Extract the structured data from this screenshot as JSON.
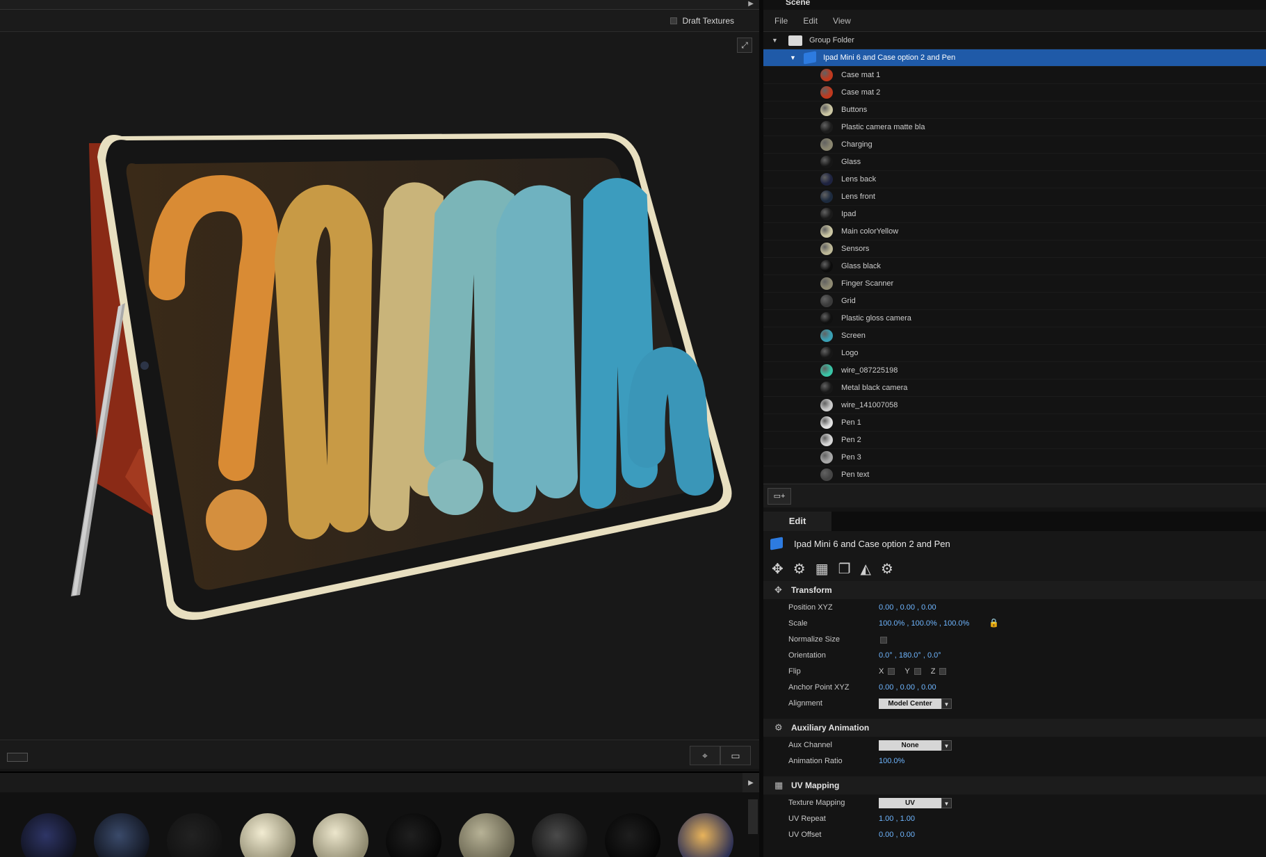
{
  "viewport": {
    "draft_textures_label": "Draft Textures",
    "expand_icon": "expand-icon"
  },
  "scene": {
    "tab_label": "Scene",
    "menu": [
      "File",
      "Edit",
      "View"
    ],
    "group_folder": "Group Folder",
    "root_item": "Ipad Mini 6 and Case option 2 and Pen",
    "materials": [
      {
        "label": "Case mat 1",
        "color": "#c0391e"
      },
      {
        "label": "Case mat 2",
        "color": "#c0391e"
      },
      {
        "label": "Buttons",
        "color": "#cbc6a3"
      },
      {
        "label": "Plastic camera matte bla",
        "color": "#1c1c1c"
      },
      {
        "label": "Charging",
        "color": "#8a8670"
      },
      {
        "label": "Glass",
        "color": "#161616"
      },
      {
        "label": "Lens back",
        "color": "#1e2340"
      },
      {
        "label": "Lens front",
        "color": "#1c2a3e"
      },
      {
        "label": "Ipad",
        "color": "#1a1a1a"
      },
      {
        "label": "Main colorYellow",
        "color": "#cbc6a3"
      },
      {
        "label": "Sensors",
        "color": "#bdb897"
      },
      {
        "label": "Glass black",
        "color": "#0c0c0c"
      },
      {
        "label": "Finger Scanner",
        "color": "#8e8a73"
      },
      {
        "label": "Grid",
        "color": "#3a3a3a"
      },
      {
        "label": "Plastic gloss camera",
        "color": "#101010"
      },
      {
        "label": "Screen",
        "color": "#3aa0b4"
      },
      {
        "label": "Logo",
        "color": "#161616"
      },
      {
        "label": "wire_087225198",
        "color": "#3ac4a6"
      },
      {
        "label": "Metal black camera",
        "color": "#181818"
      },
      {
        "label": "wire_141007058",
        "color": "#c9c9c9"
      },
      {
        "label": "Pen 1",
        "color": "#e2e2e2"
      },
      {
        "label": "Pen 2",
        "color": "#d6d6d6"
      },
      {
        "label": "Pen 3",
        "color": "#a8a8a8"
      },
      {
        "label": "Pen text",
        "color": "#454545"
      }
    ]
  },
  "edit": {
    "tab_label": "Edit",
    "title": "Ipad Mini 6 and Case option 2 and Pen",
    "transform": {
      "header": "Transform",
      "position_label": "Position XYZ",
      "position_value": "0.00 , 0.00 , 0.00",
      "scale_label": "Scale",
      "scale_value": "100.0% , 100.0% , 100.0%",
      "normalize_label": "Normalize Size",
      "orientation_label": "Orientation",
      "orientation_value": "0.0° , 180.0° , 0.0°",
      "flip_label": "Flip",
      "flip_x": "X",
      "flip_y": "Y",
      "flip_z": "Z",
      "anchor_label": "Anchor Point XYZ",
      "anchor_value": "0.00 , 0.00 , 0.00",
      "alignment_label": "Alignment",
      "alignment_value": "Model Center"
    },
    "aux": {
      "header": "Auxiliary Animation",
      "channel_label": "Aux Channel",
      "channel_value": "None",
      "ratio_label": "Animation Ratio",
      "ratio_value": "100.0%"
    },
    "uv": {
      "header": "UV Mapping",
      "mapping_label": "Texture Mapping",
      "mapping_value": "UV",
      "repeat_label": "UV Repeat",
      "repeat_value": "1.00 , 1.00",
      "offset_label": "UV Offset",
      "offset_value": "0.00 , 0.00"
    }
  }
}
